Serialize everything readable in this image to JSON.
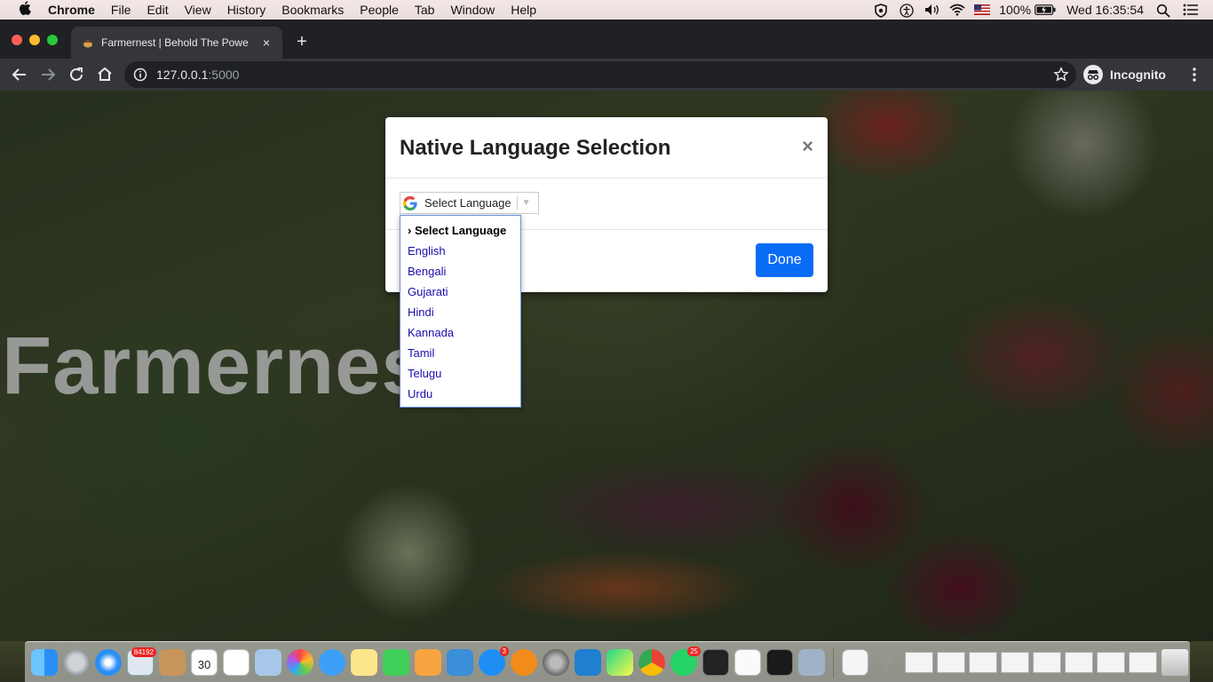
{
  "menubar": {
    "apple": "",
    "app_name": "Chrome",
    "items": [
      "File",
      "Edit",
      "View",
      "History",
      "Bookmarks",
      "People",
      "Tab",
      "Window",
      "Help"
    ],
    "battery": "100%",
    "clock": "Wed 16:35:54"
  },
  "browser": {
    "tab_title": "Farmernest | Behold The Powe",
    "tab_close": "×",
    "new_tab": "+",
    "url_host": "127.0.0.1",
    "url_port": ":5000",
    "incognito_label": "Incognito"
  },
  "page": {
    "hero_title": "Farmernest"
  },
  "modal": {
    "title": "Native Language Selection",
    "close": "×",
    "select_label": "Select Language",
    "select_arrow": "▼",
    "done_label": "Done"
  },
  "language_menu": {
    "selected": "› Select Language",
    "options": [
      "English",
      "Bengali",
      "Gujarati",
      "Hindi",
      "Kannada",
      "Tamil",
      "Telugu",
      "Urdu"
    ]
  },
  "dock": {
    "badges": {
      "mail": "84192",
      "calendar_day": "30",
      "appstore": "3",
      "whatsapp": "25"
    }
  }
}
